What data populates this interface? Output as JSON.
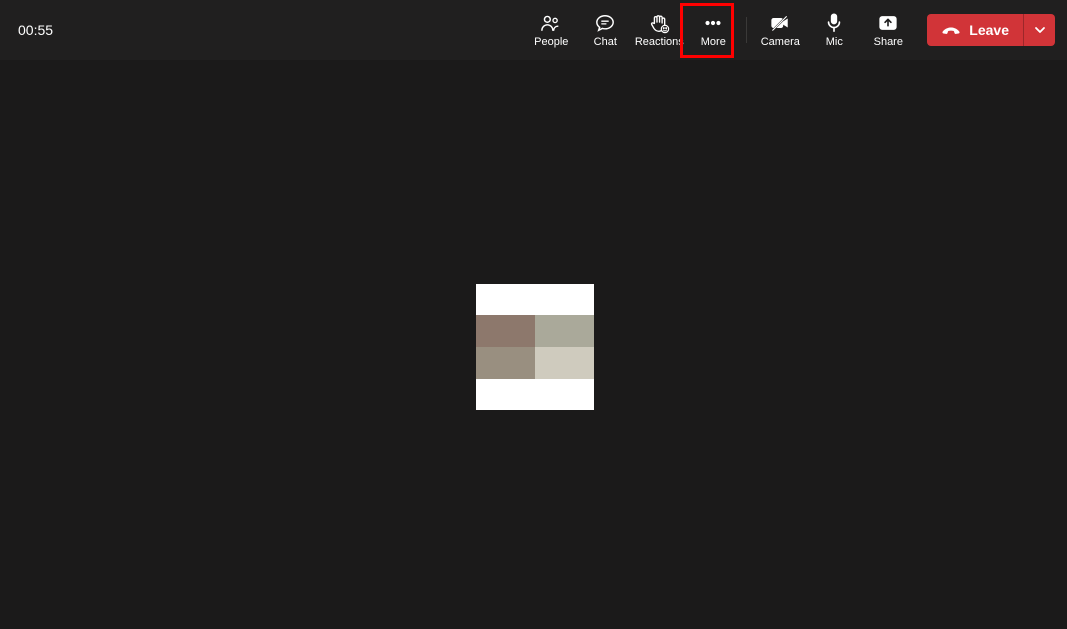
{
  "meeting": {
    "timer": "00:55"
  },
  "toolbar": {
    "people_label": "People",
    "chat_label": "Chat",
    "reactions_label": "Reactions",
    "more_label": "More",
    "camera_label": "Camera",
    "mic_label": "Mic",
    "share_label": "Share"
  },
  "leave": {
    "label": "Leave"
  },
  "highlight": {
    "target": "more-button"
  },
  "participant_tile": {
    "colors": {
      "top": "#ffffff",
      "r1c1": "#8d786c",
      "r1c2": "#aaa99a",
      "r2c1": "#998f80",
      "r2c2": "#cfcbbe",
      "bottom": "#ffffff"
    }
  }
}
